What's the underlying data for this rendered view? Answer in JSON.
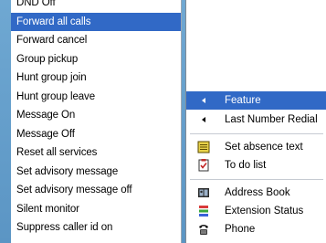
{
  "list_menu": {
    "items": [
      "DND Off",
      "Forward all calls",
      "Forward cancel",
      "Group pickup",
      "Hunt group join",
      "Hunt group leave",
      "Message On",
      "Message Off",
      "Reset all services",
      "Set advisory message",
      "Set advisory message off",
      "Silent monitor",
      "Suppress caller id on"
    ],
    "selected": "Forward all calls"
  },
  "context_menu": {
    "feature_label": "Feature",
    "last_number_redial_label": "Last Number Redial",
    "set_absence_text_label": "Set absence text",
    "to_do_list_label": "To do list",
    "address_book_label": "Address Book",
    "extension_status_label": "Extension Status",
    "phone_label": "Phone"
  },
  "colors": {
    "selection": "#3169c6",
    "background_gradient": "#5b95c4"
  }
}
